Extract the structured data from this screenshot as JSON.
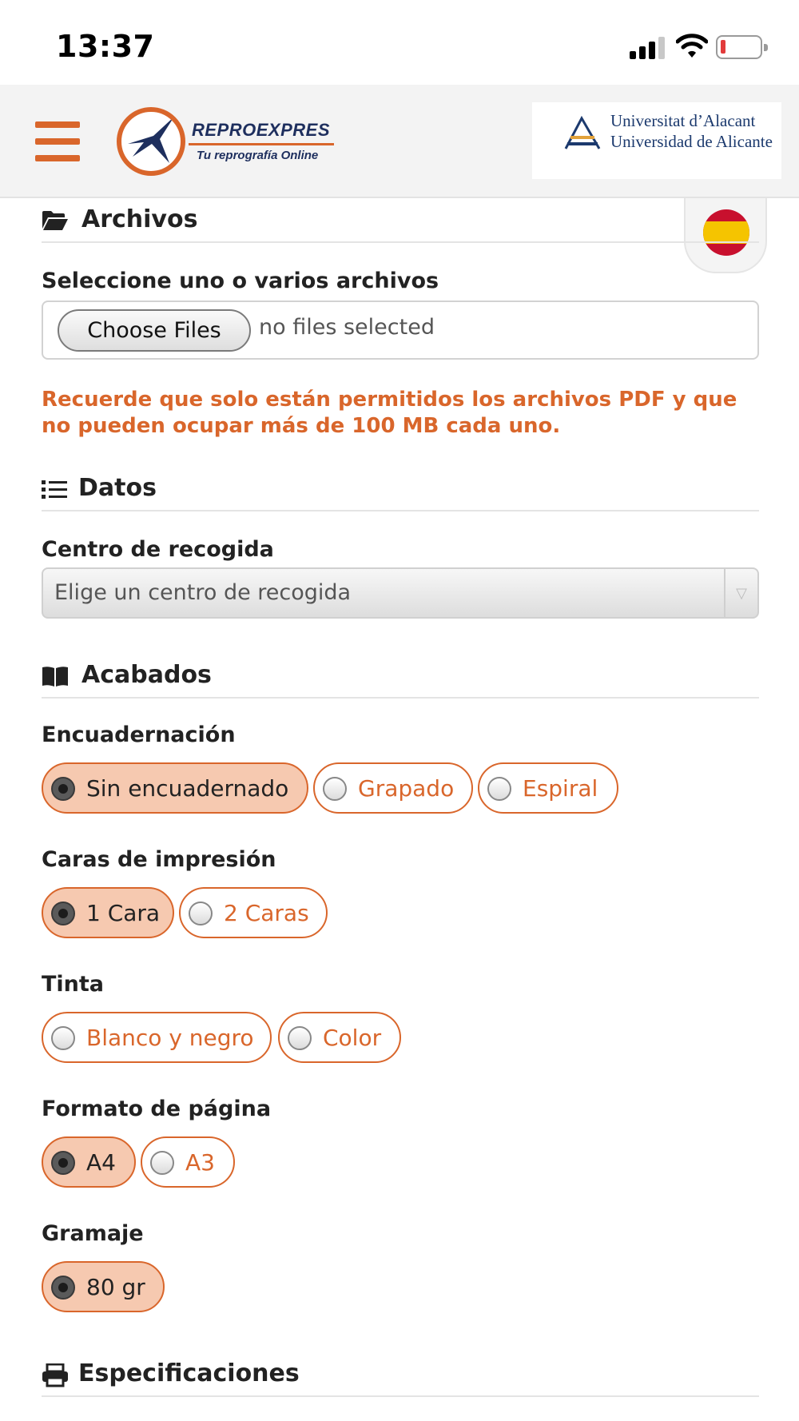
{
  "status_bar": {
    "time": "13:37"
  },
  "header": {
    "brand_name": "REPROEXPRES",
    "brand_tagline": "Tu reprografía Online",
    "university_line1": "Universitat d’Alacant",
    "university_line2": "Universidad de Alicante"
  },
  "language": {
    "flag": "spain-flag-icon"
  },
  "sections": {
    "archivos": {
      "title": "Archivos",
      "icon": "folder-open-icon"
    },
    "datos": {
      "title": "Datos",
      "icon": "list-icon"
    },
    "acabados": {
      "title": "Acabados",
      "icon": "book-icon"
    },
    "especificaciones": {
      "title": "Especificaciones",
      "icon": "printer-icon"
    }
  },
  "files": {
    "label": "Seleccione uno o varios archivos",
    "button": "Choose Files",
    "status": "no files selected",
    "notice": "Recuerde que solo están permitidos los archivos PDF y que no pueden ocupar más de 100 MB cada uno."
  },
  "pickup": {
    "label": "Centro de recogida",
    "placeholder": "Elige un centro de recogida"
  },
  "options": {
    "encuadernacion": {
      "label": "Encuadernación",
      "choices": [
        "Sin encuadernado",
        "Grapado",
        "Espiral"
      ],
      "selected": "Sin encuadernado"
    },
    "caras": {
      "label": "Caras de impresión",
      "choices": [
        "1 Cara",
        "2 Caras"
      ],
      "selected": "1 Cara"
    },
    "tinta": {
      "label": "Tinta",
      "choices": [
        "Blanco y negro",
        "Color"
      ],
      "selected": ""
    },
    "formato": {
      "label": "Formato de página",
      "choices": [
        "A4",
        "A3"
      ],
      "selected": "A4"
    },
    "gramaje": {
      "label": "Gramaje",
      "choices": [
        "80 gr"
      ],
      "selected": "80 gr"
    }
  },
  "colors": {
    "accent": "#d9662b",
    "selected_fill": "#f6c9b0",
    "brand_navy": "#1e2f5e"
  }
}
